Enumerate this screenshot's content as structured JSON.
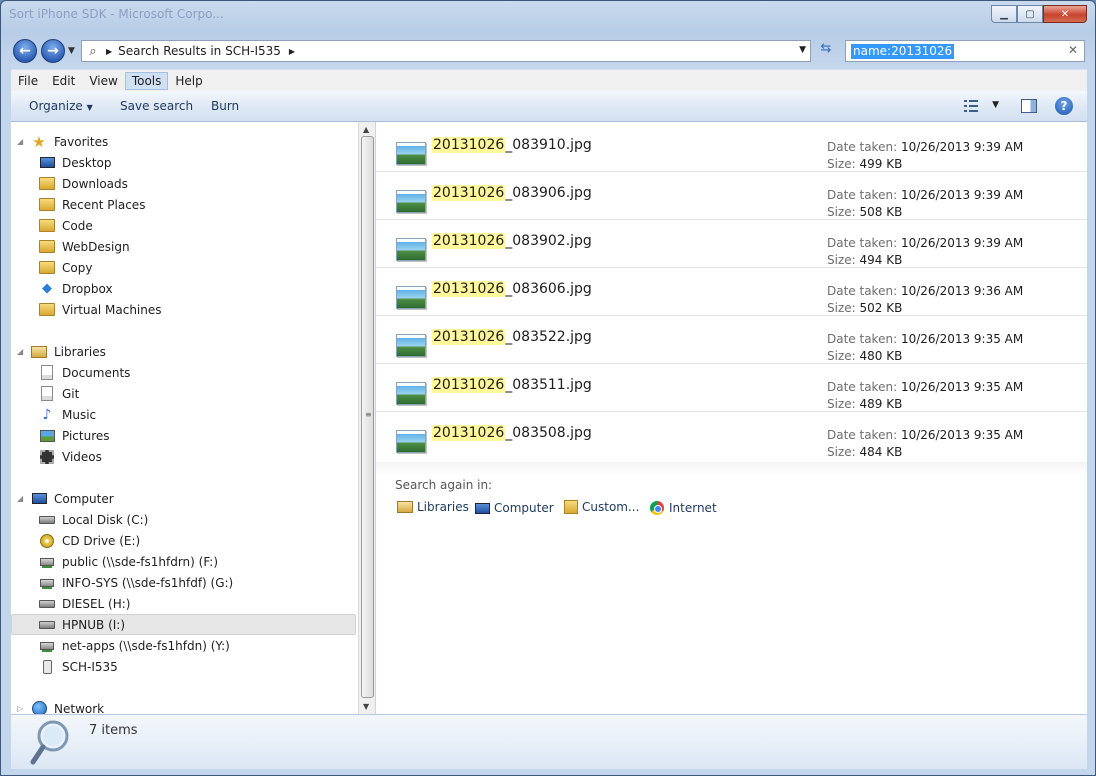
{
  "window": {
    "title": "Sort iPhone SDK - Microsoft Corpo..."
  },
  "address": {
    "path": "Search Results in SCH-I535"
  },
  "search": {
    "query": "name:20131026"
  },
  "menu": [
    "File",
    "Edit",
    "View",
    "Tools",
    "Help"
  ],
  "toolbar": {
    "organize": "Organize",
    "save_search": "Save search",
    "burn": "Burn"
  },
  "nav": {
    "favorites": {
      "label": "Favorites",
      "items": [
        "Desktop",
        "Downloads",
        "Recent Places",
        "Code",
        "WebDesign",
        "Copy",
        "Dropbox",
        "Virtual Machines"
      ]
    },
    "libraries": {
      "label": "Libraries",
      "items": [
        "Documents",
        "Git",
        "Music",
        "Pictures",
        "Videos"
      ]
    },
    "computer": {
      "label": "Computer",
      "items": [
        "Local Disk (C:)",
        "CD Drive (E:)",
        "public (\\\\sde-fs1hfdrn) (F:)",
        "INFO-SYS (\\\\sde-fs1hfdf) (G:)",
        "DIESEL (H:)",
        "HPNUB (I:)",
        "net-apps (\\\\sde-fs1hfdn) (Y:)",
        "SCH-I535"
      ]
    },
    "network": {
      "label": "Network"
    }
  },
  "results": {
    "highlight": "20131026",
    "date_label": "Date taken:",
    "size_label": "Size:",
    "items": [
      {
        "rest": "_083910.jpg",
        "date": "10/26/2013 9:39 AM",
        "size": "499 KB"
      },
      {
        "rest": "_083906.jpg",
        "date": "10/26/2013 9:39 AM",
        "size": "508 KB"
      },
      {
        "rest": "_083902.jpg",
        "date": "10/26/2013 9:39 AM",
        "size": "494 KB"
      },
      {
        "rest": "_083606.jpg",
        "date": "10/26/2013 9:36 AM",
        "size": "502 KB"
      },
      {
        "rest": "_083522.jpg",
        "date": "10/26/2013 9:35 AM",
        "size": "480 KB"
      },
      {
        "rest": "_083511.jpg",
        "date": "10/26/2013 9:35 AM",
        "size": "489 KB"
      },
      {
        "rest": "_083508.jpg",
        "date": "10/26/2013 9:35 AM",
        "size": "484 KB"
      }
    ]
  },
  "search_again": {
    "label": "Search again in:",
    "options": [
      "Libraries",
      "Computer",
      "Custom...",
      "Internet"
    ]
  },
  "status": {
    "count_text": "7 items"
  },
  "icons": {
    "back": "back-arrow-icon",
    "forward": "forward-arrow-icon",
    "refresh": "refresh-icon",
    "help": "help-icon",
    "view": "view-options-icon",
    "preview": "preview-pane-icon"
  }
}
